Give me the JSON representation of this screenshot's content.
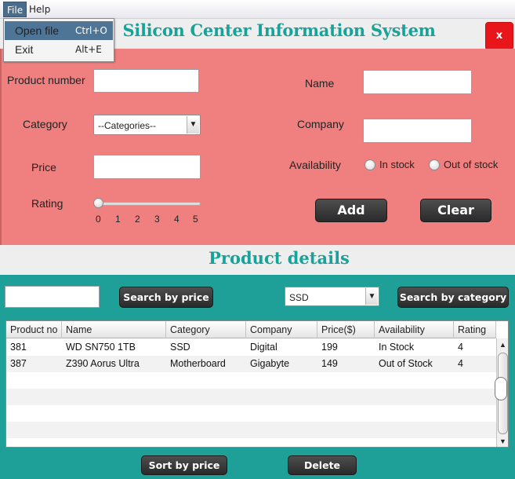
{
  "menu": {
    "file": "File",
    "help": "Help",
    "items": [
      {
        "label": "Open file",
        "accel": "Ctrl+O"
      },
      {
        "label": "Exit",
        "accel": "Alt+E"
      }
    ]
  },
  "header": {
    "title": "Silicon Center Information System",
    "close_label": "x"
  },
  "form": {
    "product_number_label": "Product number",
    "name_label": "Name",
    "category_label": "Category",
    "category_value": "--Categories--",
    "company_label": "Company",
    "price_label": "Price",
    "availability_label": "Availability",
    "in_stock_label": "In stock",
    "out_of_stock_label": "Out of stock",
    "rating_label": "Rating",
    "rating_ticks": [
      "0",
      "1",
      "2",
      "3",
      "4",
      "5"
    ],
    "rating_value": 0,
    "add_label": "Add",
    "clear_label": "Clear"
  },
  "details": {
    "title": "Product details",
    "search_price_label": "Search by price",
    "category_filter_value": "SSD",
    "search_category_label": "Search by category",
    "sort_label": "Sort by price",
    "delete_label": "Delete"
  },
  "table": {
    "columns": [
      "Product no",
      "Name",
      "Category",
      "Company",
      "Price($)",
      "Availability",
      "Rating"
    ],
    "rows": [
      [
        "381",
        "WD SN750 1TB",
        "SSD",
        "Digital",
        "199",
        "In Stock",
        "4"
      ],
      [
        "387",
        "Z390 Aorus Ultra",
        "Motherboard",
        "Gigabyte",
        "149",
        "Out of Stock",
        "4"
      ]
    ]
  },
  "colors": {
    "form_bg": "#f08080",
    "accent_teal": "#1e9f97",
    "title_teal": "#17a39a",
    "close_red": "#e8151a",
    "menu_highlight": "#4f7596"
  }
}
